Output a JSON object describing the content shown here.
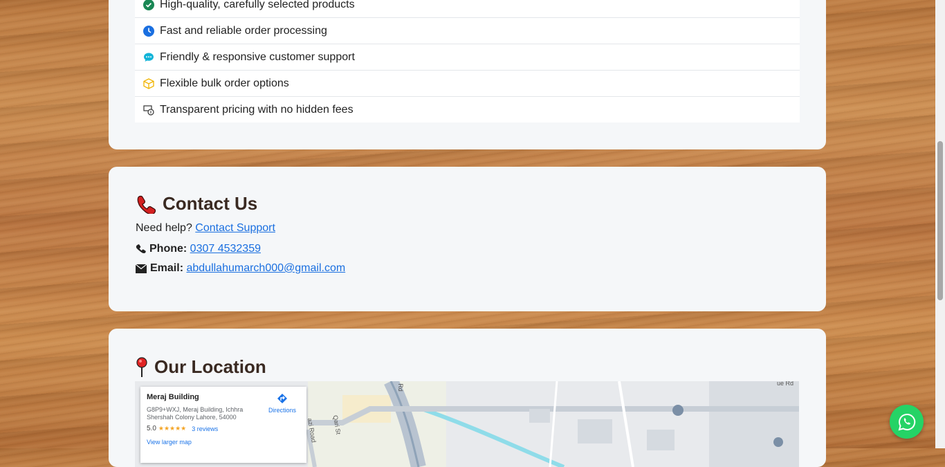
{
  "features": {
    "items": [
      {
        "icon": "check-circle-icon",
        "label": "High-quality, carefully selected products"
      },
      {
        "icon": "clock-icon",
        "label": "Fast and reliable order processing"
      },
      {
        "icon": "chat-bubble-icon",
        "label": "Friendly & responsive customer support"
      },
      {
        "icon": "package-icon",
        "label": "Flexible bulk order options"
      },
      {
        "icon": "money-icon",
        "label": "Transparent pricing with no hidden fees"
      }
    ]
  },
  "contact": {
    "title": "Contact Us",
    "help_prefix": "Need help?",
    "help_link": "Contact Support",
    "phone_label": "Phone:",
    "phone_value": "0307 4532359",
    "email_label": "Email:",
    "email_value": "abdullahumarch000@gmail.com"
  },
  "location": {
    "title": "Our Location",
    "map": {
      "place_name": "Meraj Building",
      "address": "G8P9+WXJ, Meraj Building, Ichhra Shershah Colony Lahore, 54000",
      "rating": "5.0",
      "stars": "★★★★★",
      "reviews": "3 reviews",
      "directions": "Directions",
      "larger_map": "View larger map",
      "road_labels": [
        "Rd",
        "Qari St",
        "azi Road",
        "ue Rd"
      ]
    }
  },
  "colors": {
    "accent": "#1a6fe0",
    "whatsapp": "#25d366",
    "title": "#3a2a22"
  }
}
